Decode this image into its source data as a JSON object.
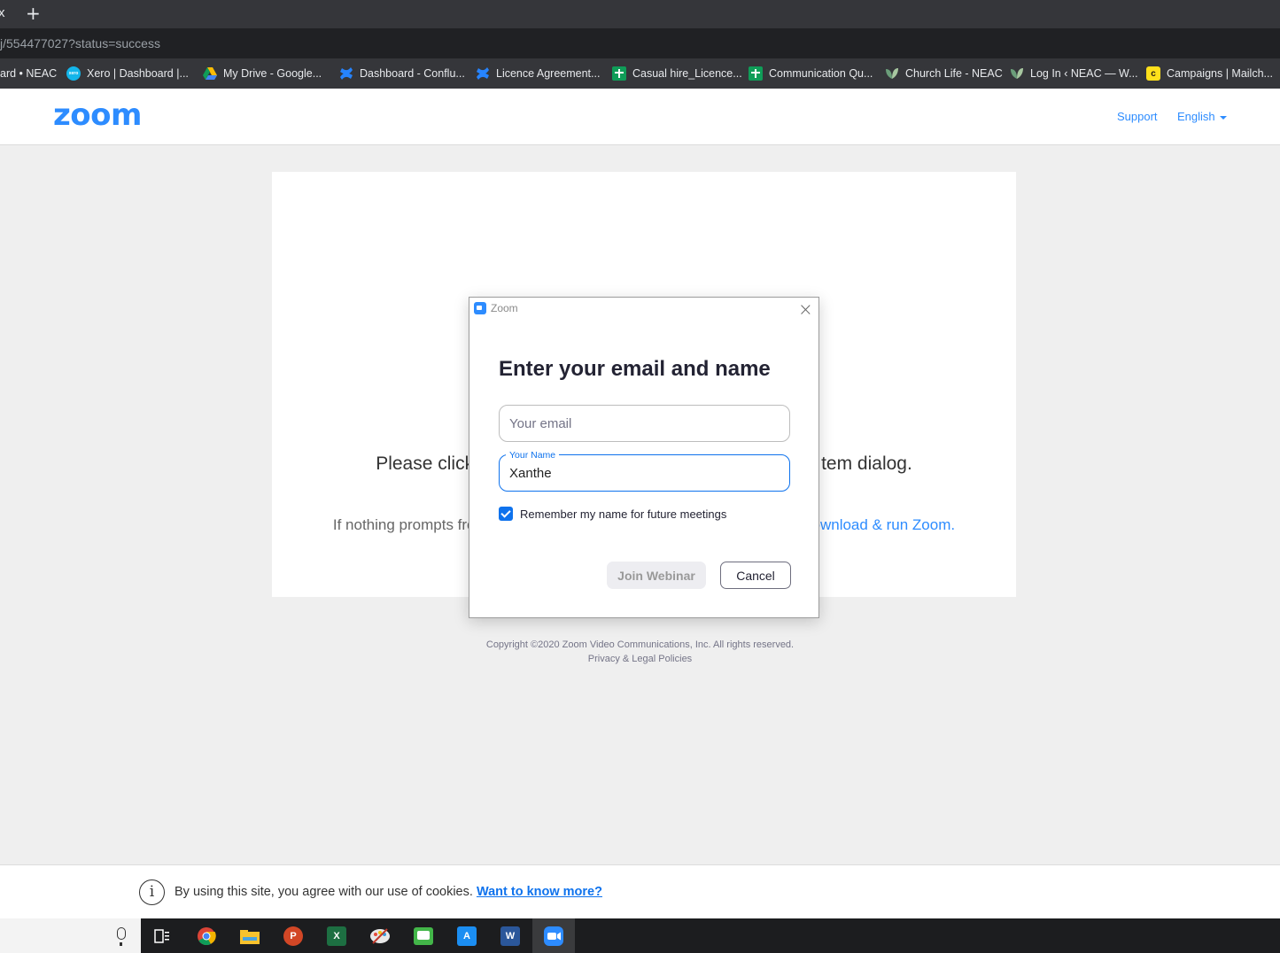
{
  "browser": {
    "tab_close": "x",
    "new_tab": "+",
    "url": "j/554477027?status=success",
    "bookmarks": [
      {
        "label": "ard • NEAC",
        "icon": "none"
      },
      {
        "label": "Xero | Dashboard |...",
        "icon": "xero-icon",
        "color": "#13b5ea"
      },
      {
        "label": "My Drive - Google...",
        "icon": "google-drive-icon",
        "color": "#fbbc04"
      },
      {
        "label": "Dashboard - Conflu...",
        "icon": "confluence-icon",
        "color": "#2684ff"
      },
      {
        "label": "Licence Agreement...",
        "icon": "confluence-icon",
        "color": "#2684ff"
      },
      {
        "label": "Casual hire_Licence...",
        "icon": "google-sheets-icon",
        "color": "#0f9d58"
      },
      {
        "label": "Communication Qu...",
        "icon": "google-sheets-icon",
        "color": "#0f9d58"
      },
      {
        "label": "Church Life - NEAC",
        "icon": "leaf-icon",
        "color": "#8fbc8f"
      },
      {
        "label": "Log In ‹ NEAC — W...",
        "icon": "leaf-icon",
        "color": "#8fbc8f"
      },
      {
        "label": "Campaigns | Mailch...",
        "icon": "mailchimp-icon",
        "color": "#ffe01b"
      }
    ]
  },
  "header": {
    "logo": "zoom",
    "support": "Support",
    "language": "English"
  },
  "card": {
    "line1_left": "Please click",
    "line1_right": "tem dialog.",
    "line2_left": "If nothing prompts fro",
    "line2_link": "ownload & run Zoom."
  },
  "footer": {
    "copyright": "Copyright ©2020 Zoom Video Communications, Inc. All rights reserved.",
    "privacy": "Privacy & Legal Policies"
  },
  "dialog": {
    "title": "Zoom",
    "close": "×",
    "heading": "Enter your email and name",
    "email_placeholder": "Your email",
    "name_label": "Your Name",
    "name_value": "Xanthe",
    "remember_label": "Remember my name for future meetings",
    "remember_checked": true,
    "join_button": "Join Webinar",
    "cancel_button": "Cancel"
  },
  "cookie": {
    "info_glyph": "i",
    "text": "By using this site, you agree with our use of cookies. ",
    "link": "Want to know more?"
  },
  "taskbar": {
    "items": [
      {
        "name": "task-view-icon",
        "glyph": "",
        "color": "#1c1d1f"
      },
      {
        "name": "chrome-icon",
        "glyph": "",
        "color": "#1c1d1f"
      },
      {
        "name": "file-explorer-icon",
        "glyph": "",
        "color": "#f8c22d"
      },
      {
        "name": "powerpoint-icon",
        "glyph": "P",
        "color": "#d24726"
      },
      {
        "name": "excel-icon",
        "glyph": "X",
        "color": "#1d6f42"
      },
      {
        "name": "paint-icon",
        "glyph": "",
        "color": "#c7c7c7"
      },
      {
        "name": "messaging-icon",
        "glyph": "",
        "color": "#43b649"
      },
      {
        "name": "affinity-icon",
        "glyph": "A",
        "color": "#1b8ef2"
      },
      {
        "name": "word-icon",
        "glyph": "W",
        "color": "#2b579a"
      },
      {
        "name": "zoom-app-icon",
        "glyph": "",
        "color": "#2d8cff"
      }
    ]
  }
}
